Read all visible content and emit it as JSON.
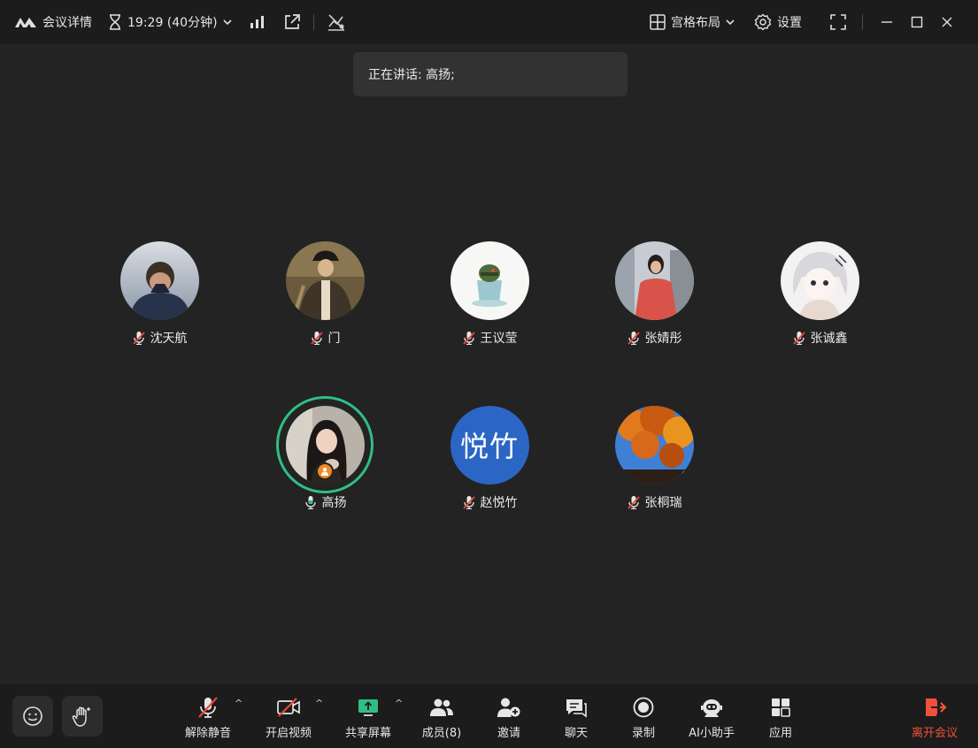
{
  "topbar": {
    "meeting_details": "会议详情",
    "timer": "19:29 (40分钟)",
    "layout_label": "宫格布局",
    "settings_label": "设置"
  },
  "speaking_banner": "正在讲话: 高扬;",
  "participants": [
    {
      "name": "沈天航",
      "mic": "muted",
      "avatar": "photo"
    },
    {
      "name": "门",
      "mic": "muted",
      "avatar": "photo"
    },
    {
      "name": "王议莹",
      "mic": "muted",
      "avatar": "photo"
    },
    {
      "name": "张婧彤",
      "mic": "muted",
      "avatar": "photo"
    },
    {
      "name": "张诚鑫",
      "mic": "muted",
      "avatar": "photo"
    },
    {
      "name": "高扬",
      "mic": "on",
      "avatar": "photo",
      "speaking": true,
      "host": true
    },
    {
      "name": "赵悦竹",
      "mic": "muted",
      "avatar": "text",
      "avatar_text": "悦竹"
    },
    {
      "name": "张桐瑞",
      "mic": "muted",
      "avatar": "photo"
    }
  ],
  "toolbar": {
    "unmute": "解除静音",
    "start_video": "开启视频",
    "share_screen": "共享屏幕",
    "members": "成员(8)",
    "invite": "邀请",
    "chat": "聊天",
    "record": "录制",
    "ai_assistant": "AI小助手",
    "apps": "应用",
    "leave": "离开会议"
  },
  "colors": {
    "background": "#232323",
    "bar": "#1c1c1c",
    "speaking_ring": "#2fbf85",
    "host_badge": "#f08a24",
    "leave": "#f0503c",
    "text_avatar": "#2b66c4",
    "share_icon": "#2fbf85"
  }
}
